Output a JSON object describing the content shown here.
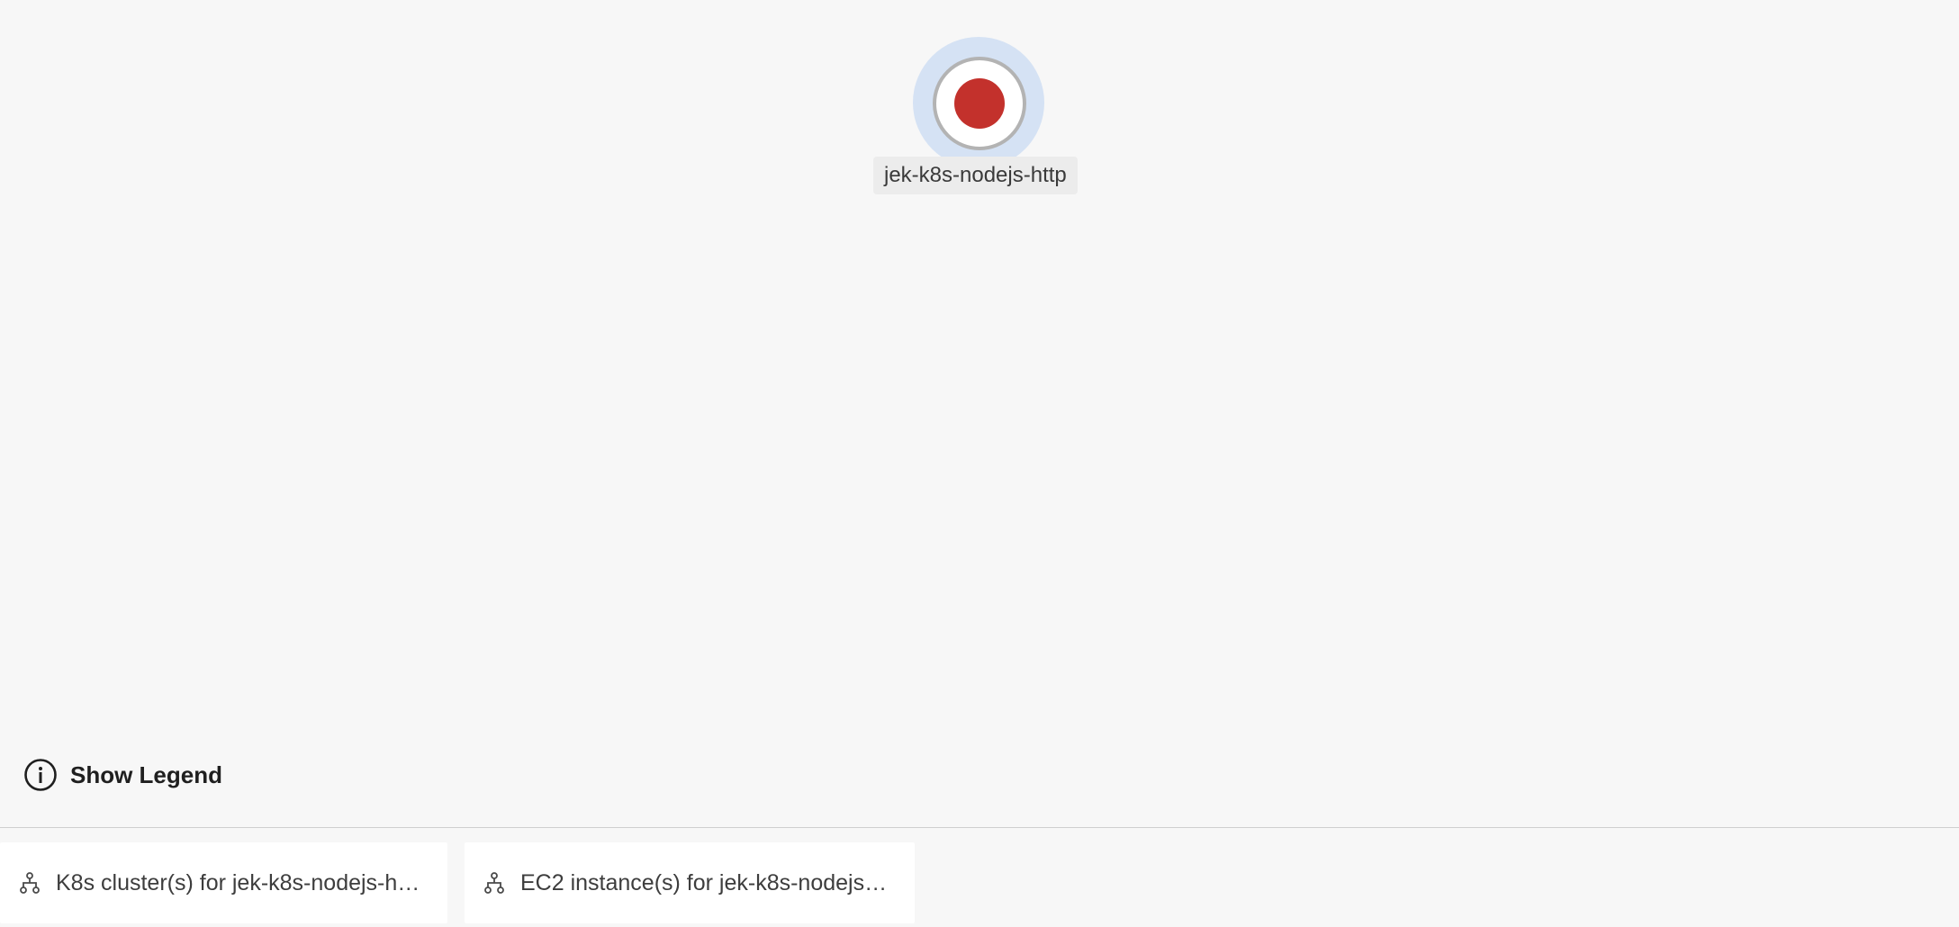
{
  "node": {
    "label": "jek-k8s-nodejs-http",
    "status_color": "#c3312c",
    "halo_color": "#d5e2f4"
  },
  "legend": {
    "label": "Show Legend",
    "icon": "info-icon"
  },
  "tabs": [
    {
      "label": "K8s cluster(s) for jek-k8s-nodejs-h…",
      "icon": "hierarchy-icon"
    },
    {
      "label": "EC2 instance(s) for jek-k8s-nodejs…",
      "icon": "hierarchy-icon"
    }
  ]
}
